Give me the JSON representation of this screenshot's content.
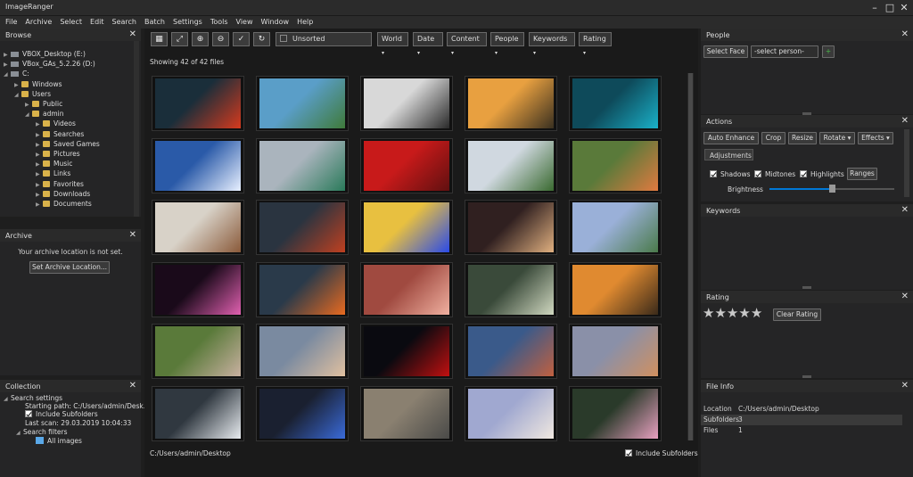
{
  "app": {
    "title": "ImageRanger"
  },
  "menu": [
    "File",
    "Archive",
    "Select",
    "Edit",
    "Search",
    "Batch",
    "Settings",
    "Tools",
    "View",
    "Window",
    "Help"
  ],
  "browse": {
    "title": "Browse",
    "items": [
      {
        "label": "VBOX_Desktop (E:)",
        "level": 0,
        "kind": "drive"
      },
      {
        "label": "VBox_GAs_5.2.26 (D:)",
        "level": 0,
        "kind": "drive"
      },
      {
        "label": "C:",
        "level": 0,
        "kind": "drive"
      },
      {
        "label": "Windows",
        "level": 1,
        "kind": "folder"
      },
      {
        "label": "Users",
        "level": 1,
        "kind": "folder"
      },
      {
        "label": "Public",
        "level": 2,
        "kind": "folder"
      },
      {
        "label": "admin",
        "level": 2,
        "kind": "folder"
      },
      {
        "label": "Videos",
        "level": 3,
        "kind": "folder"
      },
      {
        "label": "Searches",
        "level": 3,
        "kind": "folder"
      },
      {
        "label": "Saved Games",
        "level": 3,
        "kind": "folder"
      },
      {
        "label": "Pictures",
        "level": 3,
        "kind": "folder"
      },
      {
        "label": "Music",
        "level": 3,
        "kind": "folder"
      },
      {
        "label": "Links",
        "level": 3,
        "kind": "folder"
      },
      {
        "label": "Favorites",
        "level": 3,
        "kind": "folder"
      },
      {
        "label": "Downloads",
        "level": 3,
        "kind": "folder"
      },
      {
        "label": "Documents",
        "level": 3,
        "kind": "folder"
      }
    ]
  },
  "archive": {
    "title": "Archive",
    "message": "Your archive location is not set.",
    "button": "Set Archive Location..."
  },
  "collection": {
    "title": "Collection",
    "search_settings": "Search settings",
    "starting_path": "Starting path: C:/Users/admin/Desk...",
    "include_subfolders": "Include Subfolders",
    "last_scan": "Last scan: 29.03.2019 10:04:33",
    "search_filters": "Search filters",
    "all_images": "All images"
  },
  "toolbar": {
    "sort": "Unsorted",
    "filters": [
      "World",
      "Date",
      "Content",
      "People",
      "Keywords",
      "Rating"
    ],
    "icons": [
      "grid-icon",
      "fit-icon",
      "zoom-in-icon",
      "zoom-out-icon",
      "check-icon",
      "refresh-icon"
    ]
  },
  "grid": {
    "count_text": "Showing 42 of 42 files",
    "path": "C:/Users/admin/Desktop",
    "include_subfolders": "Include Subfolders",
    "thumbs": [
      [
        "#1a2e3a",
        "#d63a1e"
      ],
      [
        "#5a9ec8",
        "#3f7a3a"
      ],
      [
        "#d8d8d8",
        "#2a2a2a"
      ],
      [
        "#e8a040",
        "#3a3020"
      ],
      [
        "#0e4a5a",
        "#1ab0c8"
      ],
      [
        "#2a5aa8",
        "#e8f0ff"
      ],
      [
        "#aab4bd",
        "#2a7a5a"
      ],
      [
        "#c81a1a",
        "#601010"
      ],
      [
        "#d0d8e0",
        "#3a6a30"
      ],
      [
        "#5a7a3a",
        "#e07a40"
      ],
      [
        "#d8d2c8",
        "#8a5a3a"
      ],
      [
        "#2a3440",
        "#c04020"
      ],
      [
        "#e8c040",
        "#2a4ae8"
      ],
      [
        "#302020",
        "#e0b080"
      ],
      [
        "#9ab0d8",
        "#4a7a4a"
      ],
      [
        "#1a0a1a",
        "#e060b0"
      ],
      [
        "#2a3a4a",
        "#e86a20"
      ],
      [
        "#a04a40",
        "#f0b0a0"
      ],
      [
        "#3a4a3a",
        "#d0d8c0"
      ],
      [
        "#e08a30",
        "#3a2a1a"
      ],
      [
        "#5a7a3a",
        "#c8b0a0"
      ],
      [
        "#7a8aa0",
        "#e0c0a0"
      ],
      [
        "#0a0a10",
        "#c01010"
      ],
      [
        "#3a5a8a",
        "#c06040"
      ],
      [
        "#8a90a8",
        "#d09060"
      ],
      [
        "#303840",
        "#e8ecf0"
      ],
      [
        "#1a2030",
        "#3a6ad8"
      ],
      [
        "#8a8070",
        "#4a4a48"
      ],
      [
        "#a0a8d0",
        "#f0e8e0"
      ],
      [
        "#2a3a2a",
        "#e8a0c0"
      ]
    ]
  },
  "people": {
    "title": "People",
    "select_face": "Select Face",
    "select_person": "-select person-",
    "add": "+"
  },
  "actions": {
    "title": "Actions",
    "buttons": [
      "Auto Enhance",
      "Crop",
      "Resize",
      "Rotate",
      "Effects"
    ],
    "tab": "Adjustments",
    "checks": [
      "Shadows",
      "Midtones",
      "Highlights"
    ],
    "ranges": "Ranges",
    "brightness": "Brightness",
    "brightness_level": 0.5
  },
  "keywords": {
    "title": "Keywords"
  },
  "rating": {
    "title": "Rating",
    "stars": 5,
    "value": 5,
    "clear": "Clear Rating"
  },
  "fileinfo": {
    "title": "File Info",
    "rows": [
      [
        "Location",
        "C:/Users/admin/Desktop"
      ],
      [
        "Subfolders",
        "3"
      ],
      [
        "Files",
        "1"
      ]
    ]
  },
  "colors": {
    "accent": "#0078d7",
    "panel": "#252526",
    "star": "#c8c8c8"
  }
}
